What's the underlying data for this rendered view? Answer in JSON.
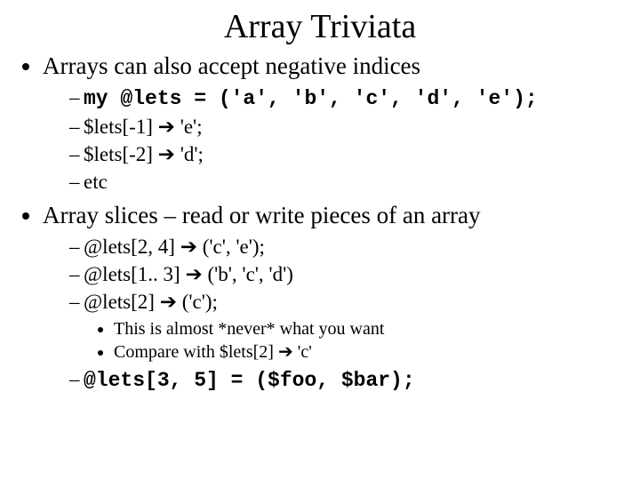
{
  "title": "Array Triviata",
  "b1": {
    "text": "Arrays can also accept negative indices",
    "s1_code": "my @lets = ('a', 'b', 'c', 'd', 'e');",
    "s2_pre": "$lets[-1] ",
    "s2_arrow": "➔",
    "s2_post": " 'e';",
    "s3_pre": "$lets[-2] ",
    "s3_arrow": "➔",
    "s3_post": " 'd';",
    "s4": "etc"
  },
  "b2": {
    "text": "Array slices – read or write pieces of an array",
    "s1_pre": "@lets[2, 4] ",
    "s1_arrow": "➔",
    "s1_post": " ('c', 'e');",
    "s2_pre": "@lets[1.. 3] ",
    "s2_arrow": "➔",
    "s2_post": " ('b', 'c', 'd')",
    "s3_pre": "@lets[2] ",
    "s3_arrow": "➔",
    "s3_post": " ('c');",
    "s3_t1": "This is almost *never* what you want",
    "s3_t2_pre": "Compare with $lets[2] ",
    "s3_t2_arrow": "➔",
    "s3_t2_post": " 'c'",
    "s4_code": "@lets[3, 5] = ($foo, $bar);"
  }
}
